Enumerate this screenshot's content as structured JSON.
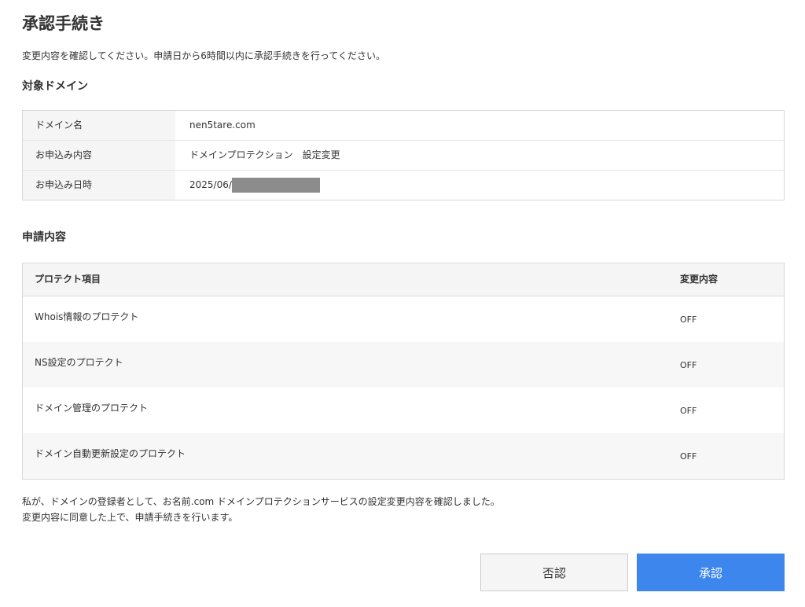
{
  "page": {
    "title": "承認手続き",
    "intro": "変更内容を確認してください。申請日から6時間以内に承認手続きを行ってください。"
  },
  "domain_section": {
    "heading": "対象ドメイン",
    "rows": [
      {
        "label": "ドメイン名",
        "value": "nen5tare.com"
      },
      {
        "label": "お申込み内容",
        "value": "ドメインプロテクション　設定変更"
      },
      {
        "label": "お申込み日時",
        "value": "2025/06/"
      }
    ]
  },
  "request_section": {
    "heading": "申請内容",
    "columns": {
      "item": "プロテクト項目",
      "change": "変更内容"
    },
    "rows": [
      {
        "item": "Whois情報のプロテクト",
        "change": "OFF"
      },
      {
        "item": "NS設定のプロテクト",
        "change": "OFF"
      },
      {
        "item": "ドメイン管理のプロテクト",
        "change": "OFF"
      },
      {
        "item": "ドメイン自動更新設定のプロテクト",
        "change": "OFF"
      }
    ]
  },
  "consent": {
    "line1": "私が、ドメインの登録者として、お名前.com ドメインプロテクションサービスの設定変更内容を確認しました。",
    "line2": "変更内容に同意した上で、申請手続きを行います。"
  },
  "buttons": {
    "reject": "否認",
    "approve": "承認"
  },
  "colors": {
    "approve_button": "#3d86ee",
    "label_background": "#f5f5f5",
    "redaction": "#8c8c8c"
  }
}
